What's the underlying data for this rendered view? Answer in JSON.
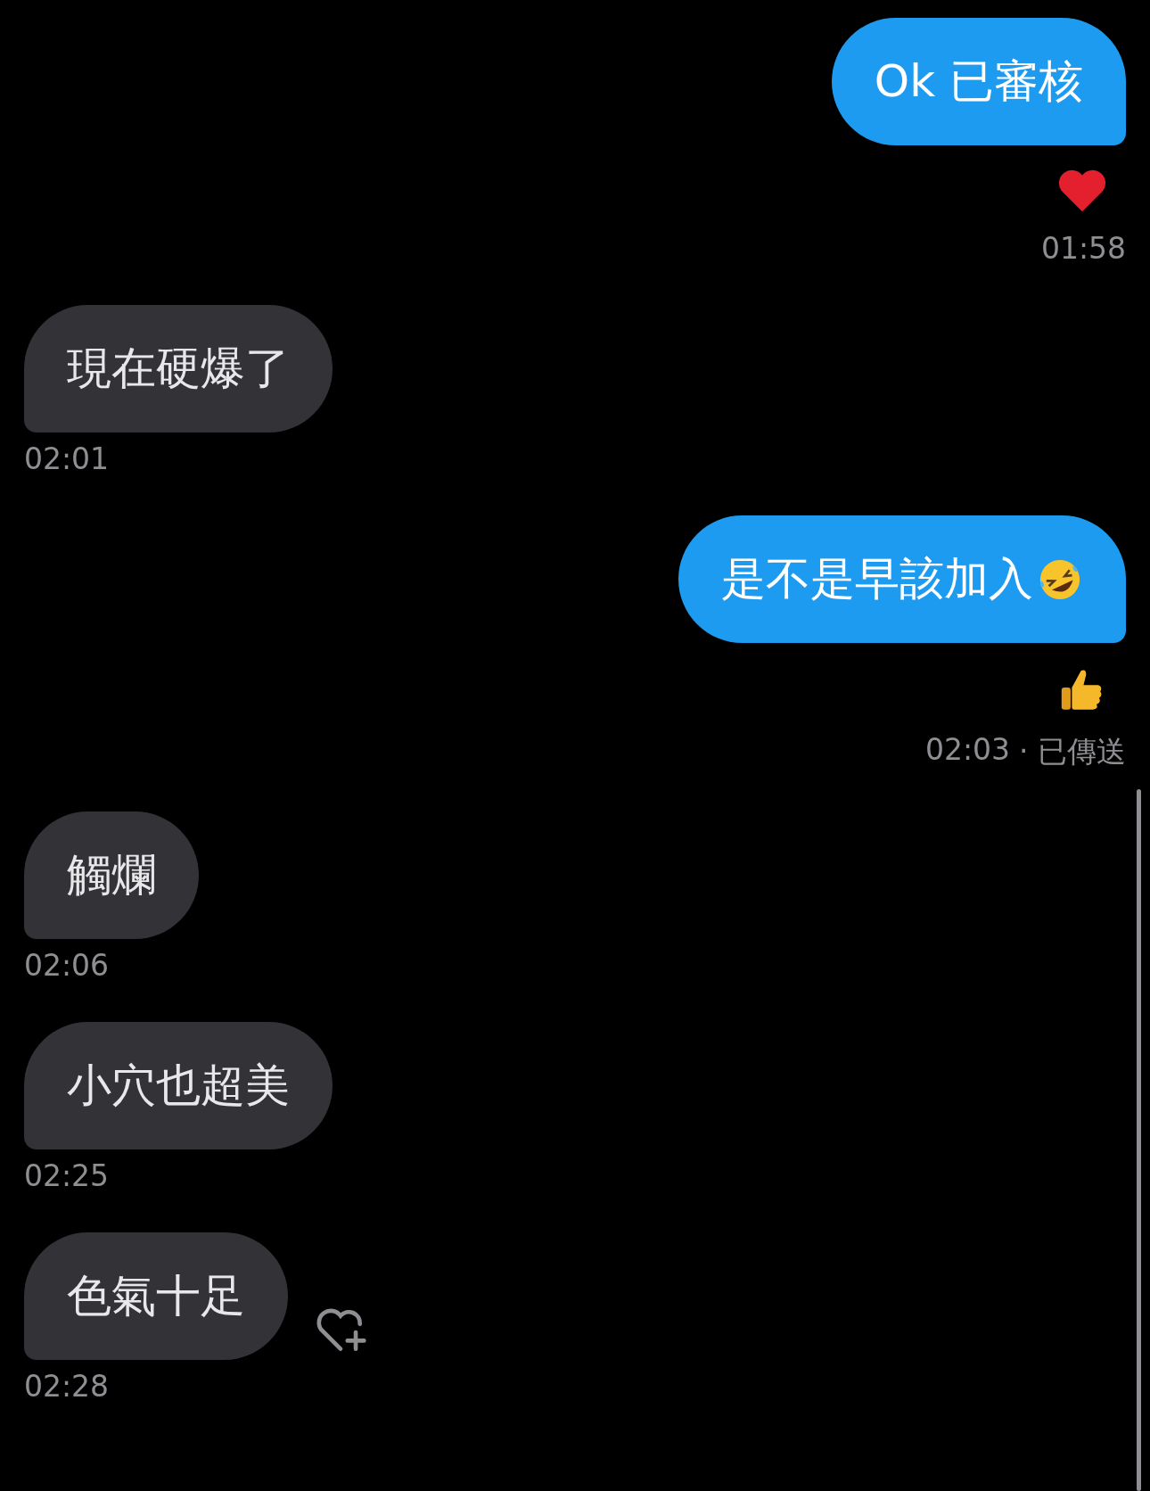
{
  "messages": [
    {
      "kind": "sent",
      "text": "Ok 已審核",
      "reaction": {
        "kind": "heart"
      },
      "time": "01:58"
    },
    {
      "kind": "received",
      "text": "現在硬爆了",
      "time": "02:01"
    },
    {
      "kind": "sent",
      "text": "是不是早該加入",
      "emoji": {
        "kind": "laughing"
      },
      "reaction": {
        "kind": "thumbs-up"
      },
      "time": "02:03",
      "status": "· 已傳送"
    },
    {
      "kind": "received",
      "text": "觸爛",
      "time": "02:06"
    },
    {
      "kind": "received",
      "text": "小穴也超美",
      "time": "02:25"
    },
    {
      "kind": "received",
      "text": "色氣十足",
      "time": "02:28",
      "react_button": true
    }
  ]
}
